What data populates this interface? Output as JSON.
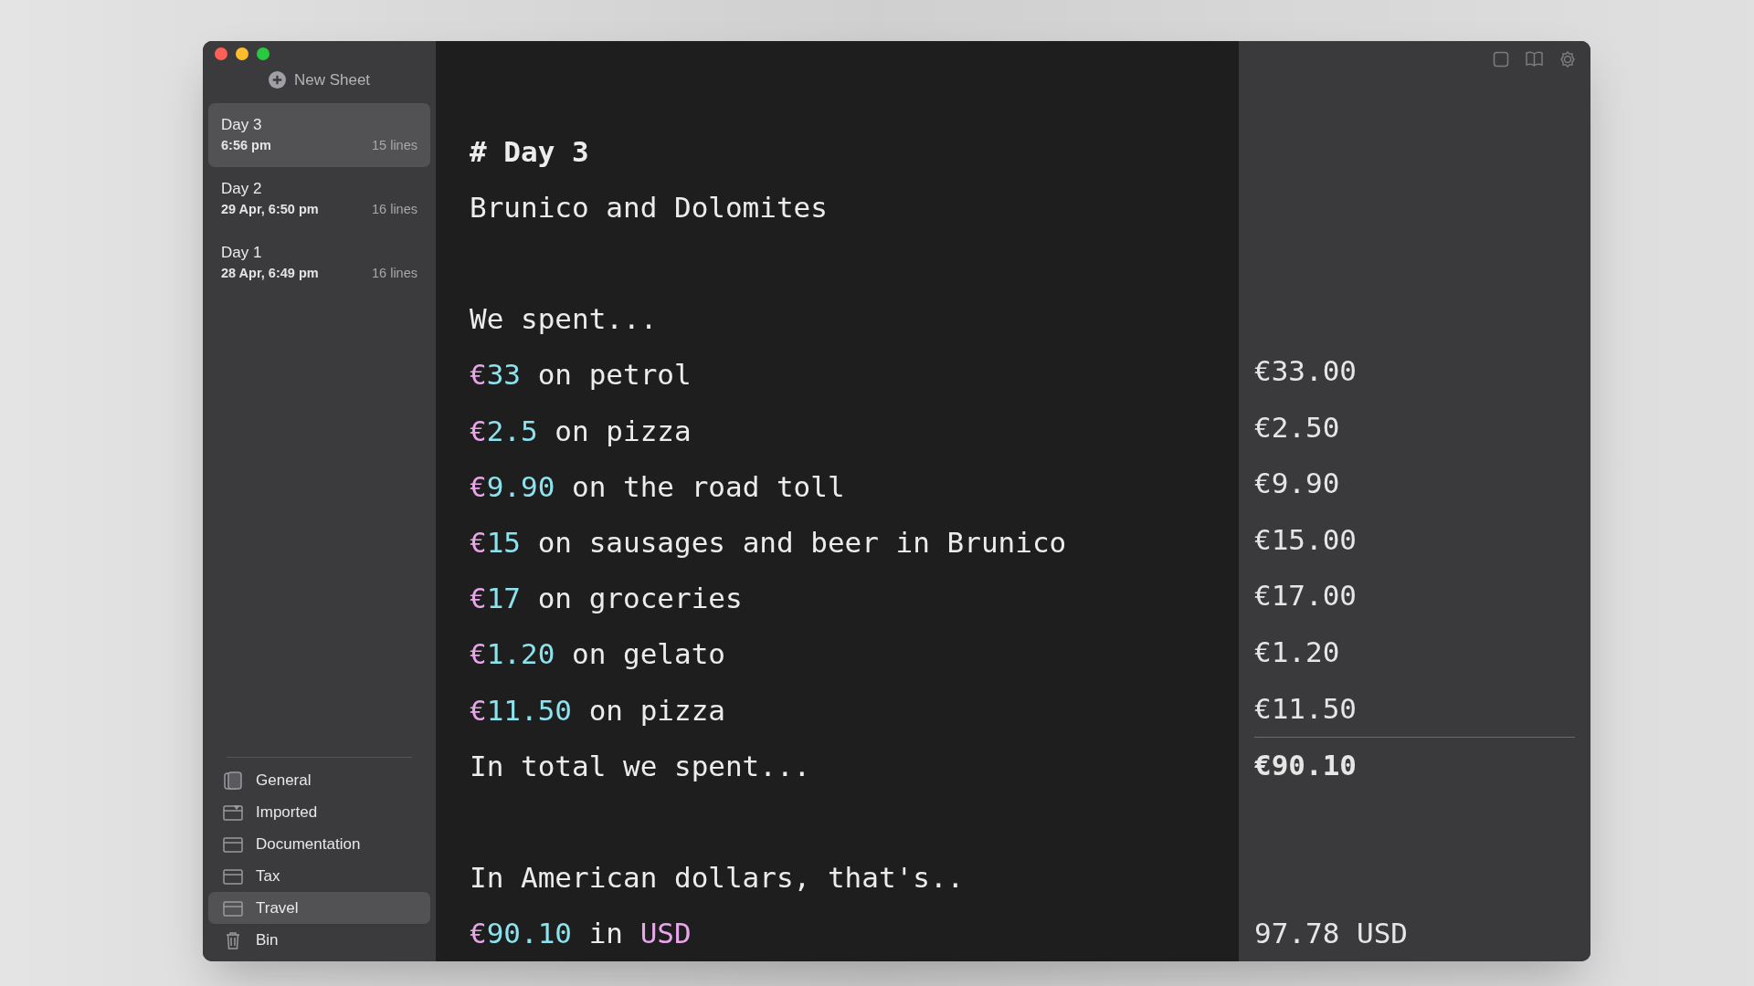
{
  "sidebar": {
    "new_sheet_button": "New Sheet",
    "sheets": [
      {
        "title": "Day 3",
        "date": "6:56 pm",
        "lines": "15 lines",
        "selected": true
      },
      {
        "title": "Day 2",
        "date": "29 Apr, 6:50 pm",
        "lines": "16 lines",
        "selected": false
      },
      {
        "title": "Day 1",
        "date": "28 Apr, 6:49 pm",
        "lines": "16 lines",
        "selected": false
      }
    ],
    "folders": [
      {
        "kind": "stack",
        "label": "General",
        "selected": false
      },
      {
        "kind": "inbox",
        "label": "Imported",
        "selected": false
      },
      {
        "kind": "folder",
        "label": "Documentation",
        "selected": false
      },
      {
        "kind": "folder",
        "label": "Tax",
        "selected": false
      },
      {
        "kind": "folder",
        "label": "Travel",
        "selected": true
      },
      {
        "kind": "trash",
        "label": "Bin",
        "selected": false
      }
    ]
  },
  "editor": {
    "lines": [
      {
        "kind": "heading",
        "segments": [
          {
            "kind": "text",
            "text": "# Day 3"
          }
        ]
      },
      {
        "kind": "text",
        "segments": [
          {
            "kind": "text",
            "text": "Brunico and Dolomites"
          }
        ]
      },
      {
        "kind": "blank"
      },
      {
        "kind": "text",
        "segments": [
          {
            "kind": "text",
            "text": "We spent..."
          }
        ]
      },
      {
        "kind": "text",
        "segments": [
          {
            "kind": "currency",
            "text": "€"
          },
          {
            "kind": "number",
            "text": "33"
          },
          {
            "kind": "text",
            "text": " on petrol"
          }
        ],
        "result": "€33.00"
      },
      {
        "kind": "text",
        "segments": [
          {
            "kind": "currency",
            "text": "€"
          },
          {
            "kind": "number",
            "text": "2.5"
          },
          {
            "kind": "text",
            "text": " on pizza"
          }
        ],
        "result": "€2.50"
      },
      {
        "kind": "text",
        "segments": [
          {
            "kind": "currency",
            "text": "€"
          },
          {
            "kind": "number",
            "text": "9.90"
          },
          {
            "kind": "text",
            "text": " on the road toll"
          }
        ],
        "result": "€9.90"
      },
      {
        "kind": "text",
        "segments": [
          {
            "kind": "currency",
            "text": "€"
          },
          {
            "kind": "number",
            "text": "15"
          },
          {
            "kind": "text",
            "text": " on sausages and beer in Brunico"
          }
        ],
        "result": "€15.00"
      },
      {
        "kind": "text",
        "segments": [
          {
            "kind": "currency",
            "text": "€"
          },
          {
            "kind": "number",
            "text": "17"
          },
          {
            "kind": "text",
            "text": " on groceries"
          }
        ],
        "result": "€17.00"
      },
      {
        "kind": "text",
        "segments": [
          {
            "kind": "currency",
            "text": "€"
          },
          {
            "kind": "number",
            "text": "1.20"
          },
          {
            "kind": "text",
            "text": " on gelato"
          }
        ],
        "result": "€1.20"
      },
      {
        "kind": "text",
        "segments": [
          {
            "kind": "currency",
            "text": "€"
          },
          {
            "kind": "number",
            "text": "11.50"
          },
          {
            "kind": "text",
            "text": " on pizza"
          }
        ],
        "result": "€11.50"
      },
      {
        "kind": "total",
        "segments": [
          {
            "kind": "text",
            "text": "In total we spent..."
          }
        ],
        "result": "€90.10"
      },
      {
        "kind": "blank"
      },
      {
        "kind": "text",
        "segments": [
          {
            "kind": "text",
            "text": "In American dollars, that's.."
          }
        ]
      },
      {
        "kind": "text",
        "segments": [
          {
            "kind": "currency",
            "text": "€"
          },
          {
            "kind": "number",
            "text": "90.10"
          },
          {
            "kind": "text",
            "text": " in "
          },
          {
            "kind": "unit",
            "text": "USD"
          }
        ],
        "result": "97.78 USD"
      }
    ]
  }
}
